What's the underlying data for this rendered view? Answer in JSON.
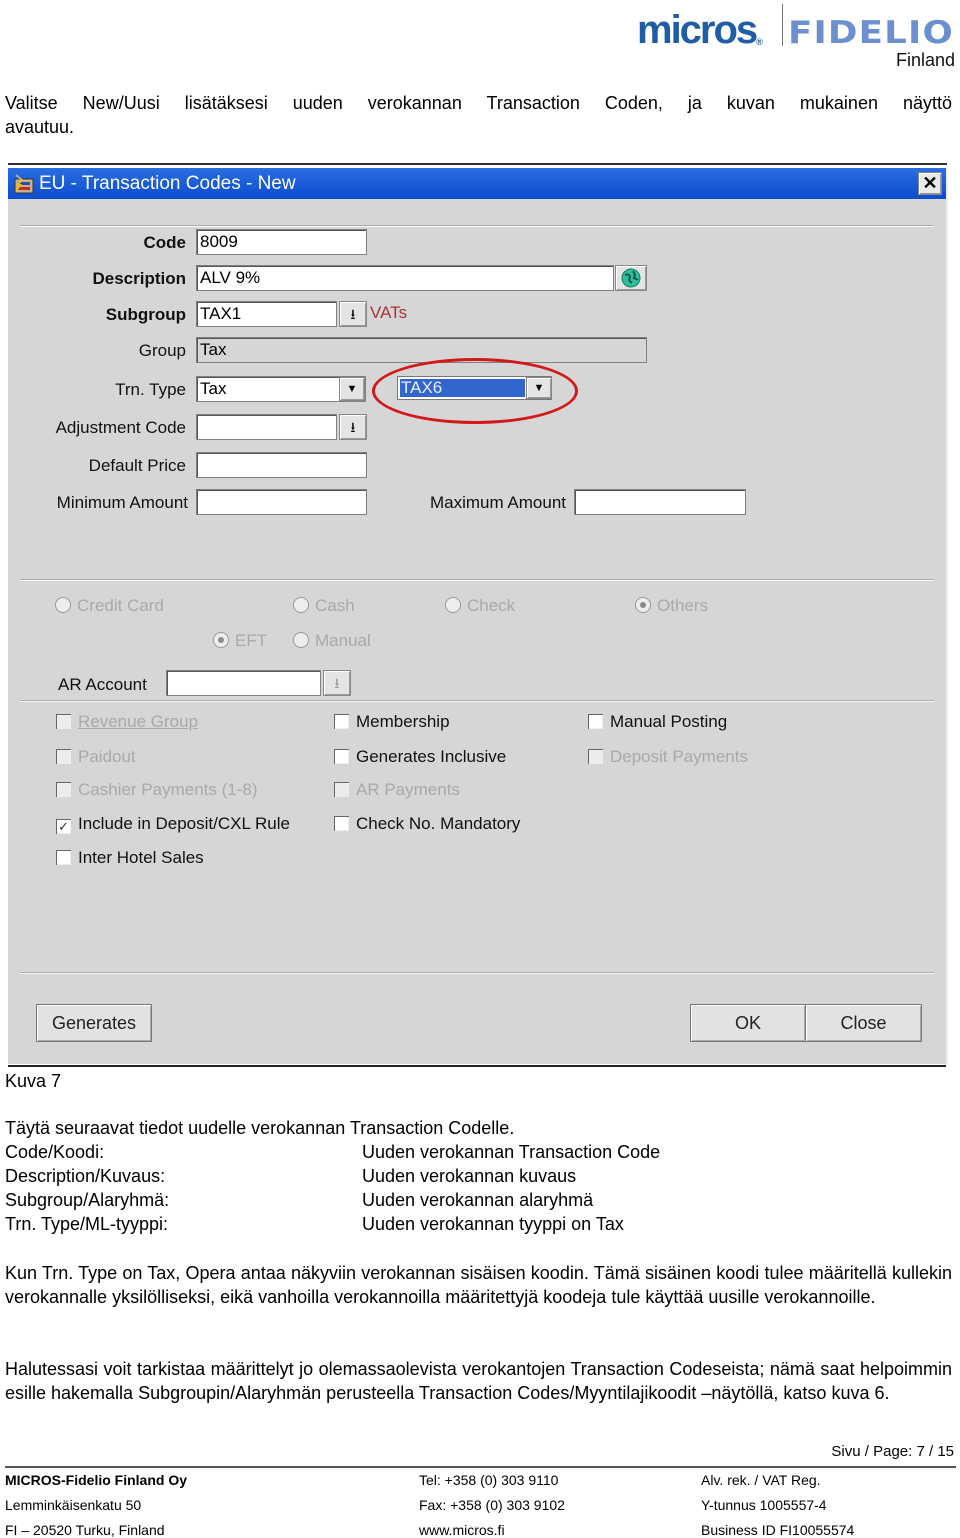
{
  "header": {
    "logo_micros": "micros",
    "logo_registered": "®",
    "logo_fidelio": "FIDELIO",
    "logo_region": "Finland"
  },
  "intro": {
    "line1": "Valitse New/Uusi lisätäksesi uuden verokannan Transaction Coden, ja kuvan mukainen näyttö",
    "line2": "avautuu."
  },
  "dialog": {
    "title": "EU - Transaction Codes - New",
    "title_icon": "application-icon",
    "close_label": "✕",
    "fields": {
      "code": {
        "label": "Code",
        "value": "8009"
      },
      "description": {
        "label": "Description",
        "value": "ALV 9%"
      },
      "subgroup": {
        "label": "Subgroup",
        "value": "TAX1",
        "hint": "VATs"
      },
      "group": {
        "label": "Group",
        "value": "Tax"
      },
      "trn_type": {
        "label": "Trn. Type",
        "value": "Tax",
        "tax_code": "TAX6"
      },
      "adjustment_code": {
        "label": "Adjustment Code",
        "value": ""
      },
      "default_price": {
        "label": "Default Price",
        "value": ""
      },
      "minimum_amount": {
        "label": "Minimum Amount",
        "value": ""
      },
      "maximum_amount": {
        "label": "Maximum Amount",
        "value": ""
      },
      "ar_account": {
        "label": "AR Account",
        "value": ""
      }
    },
    "lookup_glyph": "⭳",
    "dropdown_glyph": "▼",
    "radios": [
      {
        "label": "Credit Card",
        "selected": false
      },
      {
        "label": "Cash",
        "selected": false
      },
      {
        "label": "Check",
        "selected": false
      },
      {
        "label": "Others",
        "selected": true
      },
      {
        "label": "EFT",
        "selected": true
      },
      {
        "label": "Manual",
        "selected": false
      }
    ],
    "checkboxes": [
      {
        "label": "Revenue Group",
        "checked": false,
        "enabled": false
      },
      {
        "label": "Membership",
        "checked": false,
        "enabled": true
      },
      {
        "label": "Manual Posting",
        "checked": false,
        "enabled": true
      },
      {
        "label": "Paidout",
        "checked": false,
        "enabled": false
      },
      {
        "label": "Generates Inclusive",
        "checked": false,
        "enabled": true
      },
      {
        "label": "Deposit Payments",
        "checked": false,
        "enabled": false
      },
      {
        "label": "Cashier Payments (1-8)",
        "checked": false,
        "enabled": false
      },
      {
        "label": "AR Payments",
        "checked": false,
        "enabled": false
      },
      {
        "label": "Include in Deposit/CXL Rule",
        "checked": true,
        "enabled": true
      },
      {
        "label": "Check No. Mandatory",
        "checked": false,
        "enabled": true
      },
      {
        "label": "Inter Hotel Sales",
        "checked": false,
        "enabled": true
      }
    ],
    "check_glyph": "✓",
    "buttons": {
      "generates": "Generates",
      "ok": "OK",
      "close": "Close"
    }
  },
  "caption": "Kuva 7",
  "fill_intro": "Täytä seuraavat tiedot uudelle verokannan Transaction Codelle.",
  "fill_table": [
    {
      "label": "Code/Koodi:",
      "value": "Uuden verokannan Transaction Code"
    },
    {
      "label": "Description/Kuvaus:",
      "value": "Uuden verokannan kuvaus"
    },
    {
      "label": "Subgroup/Alaryhmä:",
      "value": "Uuden verokannan alaryhmä"
    },
    {
      "label": "Trn. Type/ML-tyyppi:",
      "value": "Uuden verokannan tyyppi on Tax"
    }
  ],
  "paragraphs": [
    "Kun Trn. Type on Tax, Opera antaa näkyviin verokannan sisäisen koodin. Tämä sisäinen koodi tulee määritellä kullekin verokannalle yksilölliseksi, eikä vanhoilla verokannoilla määritettyjä koodeja tule käyttää uusille verokannoille.",
    "Halutessasi voit tarkistaa määrittelyt jo olemassaolevista verokantojen Transaction Codeseista; nämä saat helpoimmin esille hakemalla Subgroupin/Alaryhmän perusteella Transaction Codes/Myyntilajikoodit –näytöllä, katso kuva 6."
  ],
  "footer": {
    "page": "Sivu / Page: 7 / 15",
    "company": "MICROS-Fidelio Finland Oy",
    "street": "Lemminkäisenkatu 50",
    "city": "FI – 20520 Turku, Finland",
    "tel": "Tel: +358 (0) 303 9110",
    "fax": "Fax: +358 (0) 303 9102",
    "web": "www.micros.fi",
    "vat_label": "Alv. rek. / VAT Reg.",
    "ytunnus": "Y-tunnus 1005557-4",
    "business_id": "Business ID FI10055574"
  },
  "colors": {
    "titlebar": "#0a52d8",
    "dialog_bg": "#d6d6d6",
    "highlight_oval": "#d21919",
    "vats_hint": "#a8323a",
    "selection": "#3366cc",
    "logo_micros": "#1f5da8",
    "logo_fidelio": "#6c8fd0"
  }
}
